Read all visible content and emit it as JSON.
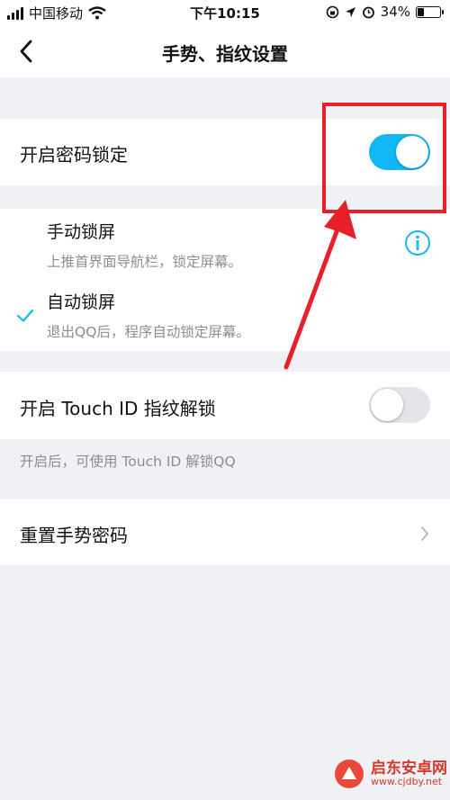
{
  "status_bar": {
    "carrier": "中国移动",
    "time": "下午10:15",
    "battery_percent": "34%",
    "battery_level": 0.34,
    "icons": [
      "signal-icon",
      "wifi-icon",
      "rotation-lock-icon",
      "location-icon",
      "alarm-icon",
      "battery-icon"
    ]
  },
  "nav": {
    "title": "手势、指纹设置",
    "back_icon": "chevron-left-icon"
  },
  "password_lock": {
    "label": "开启密码锁定",
    "enabled": true
  },
  "lock_options": [
    {
      "title": "手动锁屏",
      "desc": "上推首界面导航栏，锁定屏幕。",
      "selected": false
    },
    {
      "title": "自动锁屏",
      "desc": "退出QQ后，程序自动锁定屏幕。",
      "selected": true
    }
  ],
  "touch_id": {
    "label": "开启 Touch ID 指纹解锁",
    "enabled": false,
    "note": "开启后，可使用 Touch ID 解锁QQ"
  },
  "reset": {
    "label": "重置手势密码"
  },
  "watermark": {
    "name": "启东安卓网",
    "url": "www.cjdby.net"
  },
  "colors": {
    "accent": "#12b7f5",
    "annotation": "#e8202a",
    "background": "#f0f1f5"
  }
}
